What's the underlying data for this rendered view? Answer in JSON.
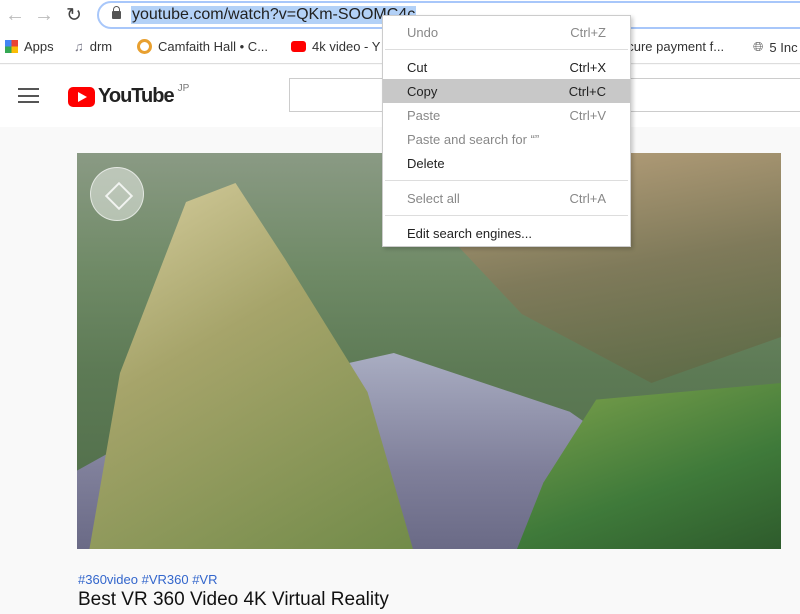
{
  "browser": {
    "url": "youtube.com/watch?v=QKm-SOOMC4c"
  },
  "bookmarks": [
    {
      "label": "Apps",
      "icon": "apps-grid-icon"
    },
    {
      "label": "drm",
      "icon": "music-icon"
    },
    {
      "label": "Camfaith Hall • C...",
      "icon": "camfaith-icon"
    },
    {
      "label": "4k video - Y",
      "icon": "youtube-icon"
    },
    {
      "label": "ecure payment f...",
      "icon": ""
    },
    {
      "label": "5 Inc",
      "icon": "globe-icon"
    }
  ],
  "youtube": {
    "logo": "YouTube",
    "region": "JP",
    "brand_color": "#ff0000"
  },
  "video": {
    "hashtags": "#360video #VR360 #VR",
    "title": "Best VR 360 Video 4K Virtual Reality"
  },
  "context_menu": {
    "items": [
      {
        "label": "Undo",
        "shortcut": "Ctrl+Z",
        "enabled": false
      },
      {
        "label": "Cut",
        "shortcut": "Ctrl+X",
        "enabled": true
      },
      {
        "label": "Copy",
        "shortcut": "Ctrl+C",
        "enabled": true,
        "highlighted": true
      },
      {
        "label": "Paste",
        "shortcut": "Ctrl+V",
        "enabled": false
      },
      {
        "label": "Paste and search for  “”",
        "shortcut": "",
        "enabled": false
      },
      {
        "label": "Delete",
        "shortcut": "",
        "enabled": true
      },
      {
        "label": "Select all",
        "shortcut": "Ctrl+A",
        "enabled": false
      },
      {
        "label": "Edit search engines...",
        "shortcut": "",
        "enabled": true
      }
    ]
  }
}
